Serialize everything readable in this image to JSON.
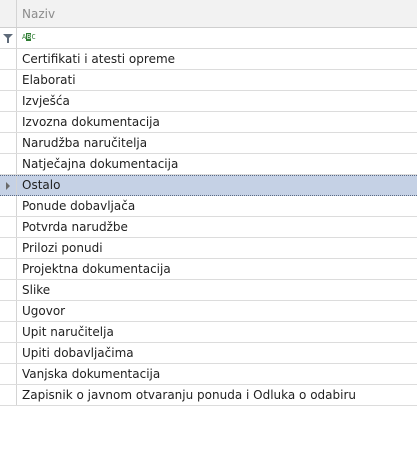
{
  "grid": {
    "column_header": "Naziv",
    "filter_icon": "funnel-icon",
    "filter_condition_icon": "abc-text-icon",
    "filter_condition_text": {
      "a": "A",
      "b": "B",
      "c": "C"
    },
    "selected_index": 6,
    "selection_color": "#c5d1e5",
    "rows": [
      "Certifikati i atesti opreme",
      "Elaborati",
      "Izvješća",
      "Izvozna dokumentacija",
      "Narudžba naručitelja",
      "Natječajna dokumentacija",
      "Ostalo",
      "Ponude dobavljača",
      "Potvrda narudžbe",
      "Prilozi ponudi",
      "Projektna dokumentacija",
      "Slike",
      "Ugovor",
      "Upit naručitelja",
      "Upiti dobavljačima",
      "Vanjska dokumentacija",
      "Zapisnik o javnom otvaranju ponuda i Odluka o odabiru"
    ]
  }
}
